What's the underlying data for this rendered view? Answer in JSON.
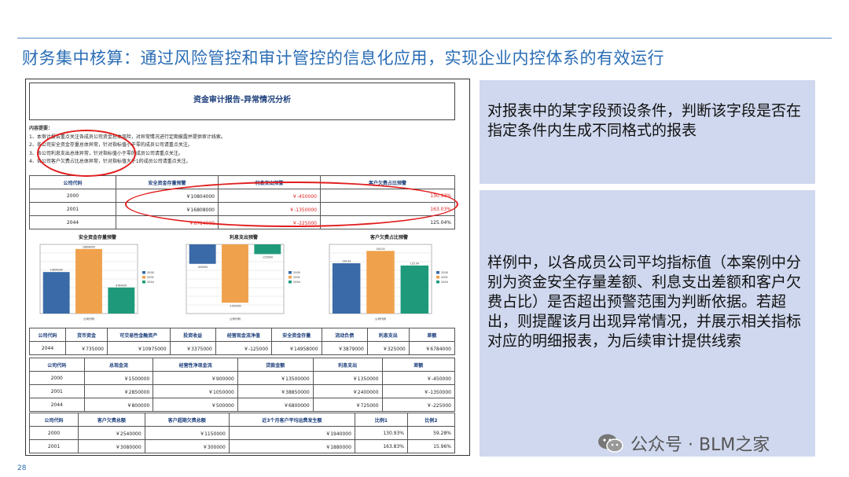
{
  "title": "财务集中核算：通过风险管控和审计管控的信息化应用，实现企业内控体系的有效运行",
  "page_number": "28",
  "watermark": "公众号 · BLM之家",
  "report": {
    "title": "资金审计报告-异常情况分析",
    "summary_head": "内容提要：",
    "summary_lines": [
      "1、本审计报告重点关注各成员公司资金总体风险，对异常情况进行定期披露并提供审计线索。",
      "2、各公司安全资金存量总体异常，针对指标值小于零的成员公司请重点关注。",
      "3、各公司利息支出总体异常，针对指标值小于零的成员公司请重点关注。",
      "4、各公司客户欠费占比总体异常，针对指标值大于1的成员公司请重点关注。"
    ],
    "table1": {
      "headers": [
        "公司代码",
        "安全资金存量预警",
        "利息支出预警",
        "客户欠费占比预警"
      ],
      "rows": [
        [
          "2000",
          "￥10804000",
          "￥-450000",
          "130.93%"
        ],
        [
          "2001",
          "￥16808000",
          "￥-1350000",
          "163.03%"
        ],
        [
          "2044",
          "￥6784000",
          "￥-225000",
          "125.04%"
        ]
      ]
    },
    "table2": {
      "headers": [
        "公司代码",
        "货币资金",
        "可交易性金融资产",
        "投资收益",
        "经营现金流净值",
        "安全资金存量",
        "流动负债",
        "利息支出",
        "差额"
      ],
      "rows": [
        [
          "2044",
          "￥735000",
          "￥10975000",
          "￥3375000",
          "￥-125000",
          "￥14958000",
          "￥3879000",
          "￥325000",
          "￥6784000"
        ]
      ]
    },
    "table3": {
      "headers": [
        "公司代码",
        "总现金流",
        "经营性净现金流",
        "贷款金额",
        "利息支出",
        "差额"
      ],
      "rows": [
        [
          "2000",
          "￥1500000",
          "￥900000",
          "￥13500000",
          "￥1350000",
          "￥-450000"
        ],
        [
          "2001",
          "￥2850000",
          "￥1050000",
          "￥38850000",
          "￥2400000",
          "￥-1350000"
        ],
        [
          "2044",
          "￥800000",
          "￥500000",
          "￥6800000",
          "￥725000",
          "￥-225000"
        ]
      ]
    },
    "table4": {
      "headers": [
        "公司代码",
        "客户欠费总额",
        "客户超期欠费总额",
        "近3个月客户平均运费发生额",
        "比例1",
        "比例2"
      ],
      "rows": [
        [
          "2000",
          "￥2540000",
          "￥1150000",
          "￥1940000",
          "130.93%",
          "59.28%"
        ],
        [
          "2001",
          "￥3080000",
          "￥300000",
          "￥1880000",
          "163.83%",
          "15.96%"
        ]
      ]
    }
  },
  "colors": {
    "bar_2000": "#3a6aa8",
    "bar_2001": "#f0a14c",
    "bar_2044": "#1e9a7a",
    "accent": "#2a6db5",
    "highlight": "#e11d1d",
    "panel_bg": "#cfd8ee"
  },
  "chart_data": [
    {
      "type": "bar",
      "title": "安全资金存量预警",
      "categories": [
        "2000",
        "2001",
        "2044"
      ],
      "values": [
        10804000,
        16808000,
        6784000
      ],
      "ylim": [
        0,
        18000000
      ],
      "xlabel": "公司代码",
      "legend": "right",
      "grid": true
    },
    {
      "type": "bar",
      "title": "利息支出预警",
      "categories": [
        "2000",
        "2001",
        "2044"
      ],
      "values": [
        -450000,
        -1350000,
        -225000
      ],
      "ylim": [
        -1600000,
        0
      ],
      "xlabel": "公司代码",
      "legend": "right",
      "grid": true
    },
    {
      "type": "bar",
      "title": "客户欠费占比预警",
      "categories": [
        "2000",
        "2001",
        "2044"
      ],
      "values": [
        130.93,
        163.03,
        125.04
      ],
      "ylim": [
        0,
        180
      ],
      "xlabel": "公司代码",
      "legend": "right",
      "grid": true
    }
  ],
  "panels": [
    {
      "text": "对报表中的某字段预设条件，判断该字段是否在指定条件内生成不同格式的报表"
    },
    {
      "text": "样例中，以各成员公司平均指标值（本案例中分别为资金安全存量差额、利息支出差额和客户欠费占比）是否超出预警范围为判断依据。若超出，则提醒该月出现异常情况，并展示相关指标对应的明细报表，为后续审计提供线索"
    }
  ]
}
